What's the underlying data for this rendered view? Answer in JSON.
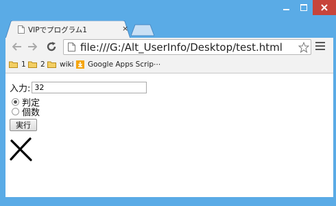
{
  "window": {
    "tab_title": "VIPでプログラム1",
    "tab_close": "×",
    "frame_color": "#5aabe6",
    "close_color": "#c7443a"
  },
  "toolbar": {
    "url": "file:///G:/Alt_UserInfo/Desktop/test.html",
    "icons": [
      "back-arrow-icon",
      "forward-arrow-icon",
      "reload-icon",
      "page-icon",
      "star-icon",
      "menu-icon"
    ]
  },
  "bookmarks": [
    {
      "label": "1",
      "icon": "folder-icon"
    },
    {
      "label": "2",
      "icon": "folder-icon"
    },
    {
      "label": "wiki",
      "icon": "folder-icon"
    },
    {
      "label": "Google Apps Scrip⋯",
      "icon": "apps-script-icon"
    }
  ],
  "form": {
    "input_label": "入力:",
    "input_value": "32",
    "options": [
      {
        "label": "判定",
        "selected": true
      },
      {
        "label": "個数",
        "selected": false
      }
    ],
    "submit_label": "実行"
  },
  "result": {
    "mark": "cross-mark"
  }
}
